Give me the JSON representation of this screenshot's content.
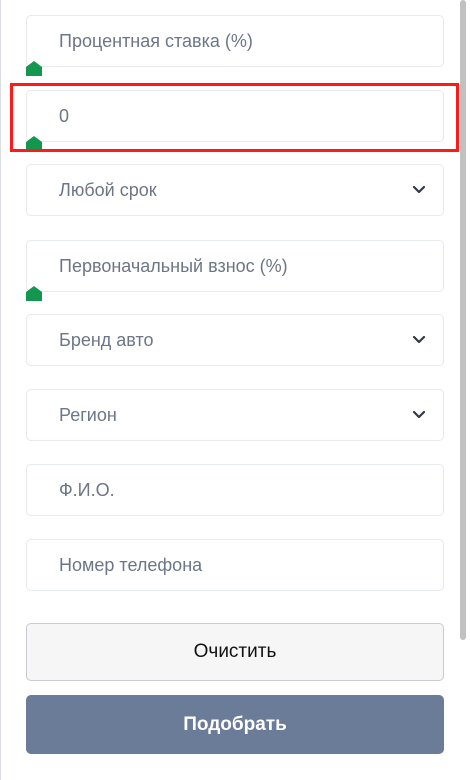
{
  "form": {
    "rate_field": {
      "placeholder": "Процентная ставка (%)"
    },
    "amount_field": {
      "value": "0"
    },
    "term_select": {
      "selected": "Любой срок"
    },
    "down_payment_field": {
      "placeholder": "Первоначальный взнос (%)"
    },
    "brand_select": {
      "selected": "Бренд авто"
    },
    "region_select": {
      "selected": "Регион"
    },
    "name_field": {
      "placeholder": "Ф.И.О."
    },
    "phone_field": {
      "placeholder": "Номер телефона"
    }
  },
  "buttons": {
    "clear_label": "Очистить",
    "submit_label": "Подобрать"
  },
  "colors": {
    "accent": "#6b7c98",
    "marker": "#13974f",
    "highlight": "#ff1a1a"
  },
  "icons": {
    "marker": "home-marker-icon",
    "dropdown": "chevron-down-icon"
  }
}
